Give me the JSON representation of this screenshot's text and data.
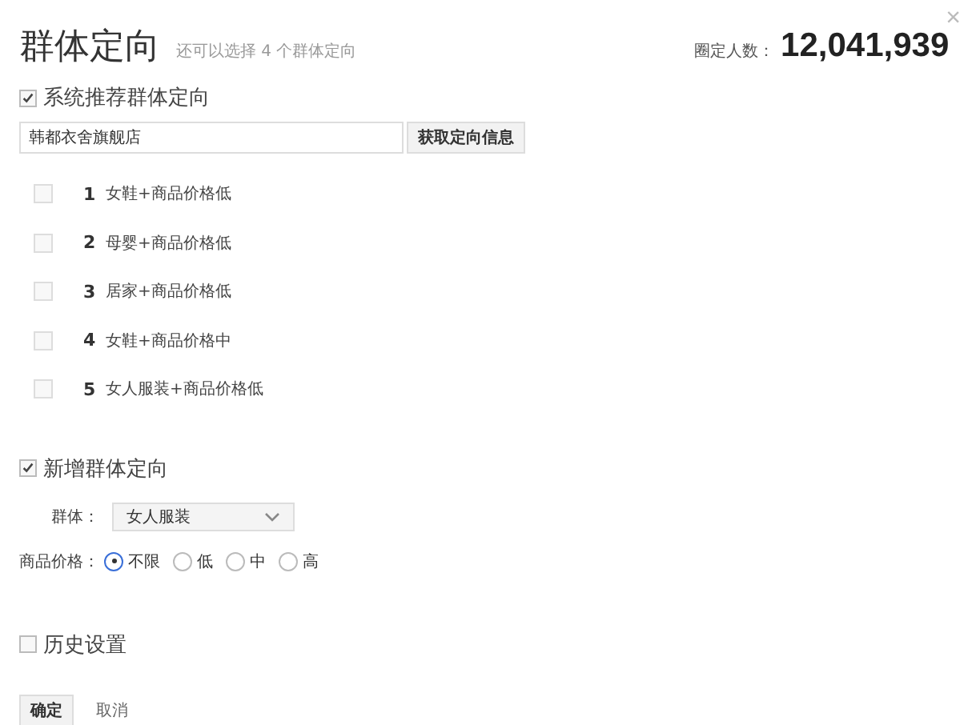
{
  "dialog": {
    "title": "群体定向",
    "hint": "还可以选择 4 个群体定向",
    "count_label": "圈定人数：",
    "count": "12,041,939",
    "close": "×"
  },
  "recommended": {
    "label": "系统推荐群体定向",
    "checked": true,
    "shop_input": "韩都衣舍旗舰店",
    "fetch_button": "获取定向信息",
    "items": [
      {
        "index": "1",
        "label": "女鞋+商品价格低",
        "checked": false
      },
      {
        "index": "2",
        "label": "母婴+商品价格低",
        "checked": false
      },
      {
        "index": "3",
        "label": "居家+商品价格低",
        "checked": false
      },
      {
        "index": "4",
        "label": "女鞋+商品价格中",
        "checked": false
      },
      {
        "index": "5",
        "label": "女人服装+商品价格低",
        "checked": false
      }
    ]
  },
  "custom": {
    "label": "新增群体定向",
    "checked": true,
    "group_label": "群体：",
    "group_value": "女人服装",
    "price_label": "商品价格：",
    "price_options": [
      {
        "label": "不限",
        "selected": true
      },
      {
        "label": "低",
        "selected": false
      },
      {
        "label": "中",
        "selected": false
      },
      {
        "label": "高",
        "selected": false
      }
    ]
  },
  "history": {
    "label": "历史设置",
    "checked": false
  },
  "buttons": {
    "confirm": "确定",
    "cancel": "取消"
  }
}
